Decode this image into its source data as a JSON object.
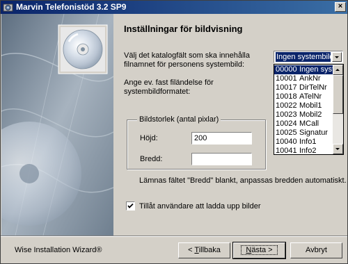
{
  "window": {
    "title": "Marvin Telefonistöd 3.2 SP9"
  },
  "heading": "Inställningar för bildvisning",
  "catalog_prompt": "Välj det katalogfält som ska innehålla filnamnet för personens systembild:",
  "catalog_select": {
    "selected": "Ingen systembild"
  },
  "catalog_options": [
    {
      "code": "00000",
      "name": "Ingen systembild"
    },
    {
      "code": "10001",
      "name": "AnkNr"
    },
    {
      "code": "10017",
      "name": "DirTelNr"
    },
    {
      "code": "10018",
      "name": "ATelNr"
    },
    {
      "code": "10022",
      "name": "Mobil1"
    },
    {
      "code": "10023",
      "name": "Mobil2"
    },
    {
      "code": "10024",
      "name": "MCall"
    },
    {
      "code": "10025",
      "name": "Signatur"
    },
    {
      "code": "10040",
      "name": "Info1"
    },
    {
      "code": "10041",
      "name": "Info2"
    }
  ],
  "suffix_prompt": "Ange ev. fast filändelse för systembildformatet:",
  "size_group": {
    "title": "Bildstorlek (antal pixlar)",
    "height_label": "Höjd:",
    "height_value": "200",
    "width_label": "Bredd:",
    "width_value": ""
  },
  "width_note": "Lämnas fältet \"Bredd\" blankt, anpassas bredden automatiskt.",
  "allow_upload": {
    "label": "Tillåt användare att ladda upp bilder",
    "checked": true
  },
  "footer": {
    "brand": "Wise Installation Wizard®",
    "back_label": "< Tillbaka",
    "next_label": "Nästa >",
    "cancel_label": "Avbryt"
  },
  "colors": {
    "titlebar": "#0a246a",
    "selection": "#0a246a",
    "face": "#d4d0c8"
  }
}
